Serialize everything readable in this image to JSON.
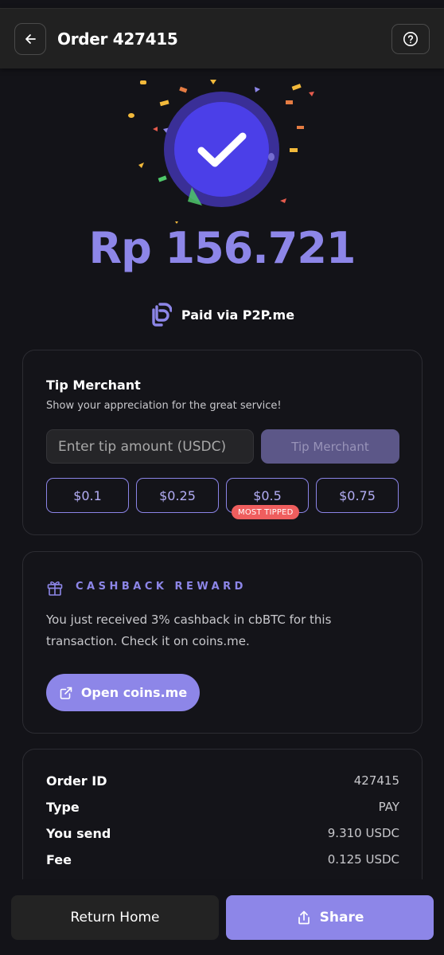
{
  "header": {
    "title": "Order 427415",
    "back_icon": "arrow-left-icon",
    "help_icon": "question-circle-icon"
  },
  "hero": {
    "amount": "Rp 156.721",
    "paid_label": "Paid via P2P.me",
    "accent": "#8d86e8",
    "check_color": "#4b3fe8"
  },
  "tip": {
    "title": "Tip Merchant",
    "subtitle": "Show your appreciation for the great service!",
    "input_placeholder": "Enter tip amount (USDC)",
    "input_value": "",
    "button_label": "Tip Merchant",
    "options": [
      "$0.1",
      "$0.25",
      "$0.5",
      "$0.75"
    ],
    "badge": "MOST TIPPED"
  },
  "cashback": {
    "title": "CASHBACK REWARD",
    "text": "You just received 3% cashback in cbBTC for this transaction. Check it on coins.me.",
    "button_label": "Open coins.me"
  },
  "order": {
    "rows": [
      {
        "label": "Order ID",
        "value": "427415"
      },
      {
        "label": "Type",
        "value": "PAY"
      },
      {
        "label": "You send",
        "value": "9.310 USDC"
      },
      {
        "label": "Fee",
        "value": "0.125 USDC"
      }
    ]
  },
  "footer": {
    "home_label": "Return Home",
    "share_label": "Share"
  }
}
